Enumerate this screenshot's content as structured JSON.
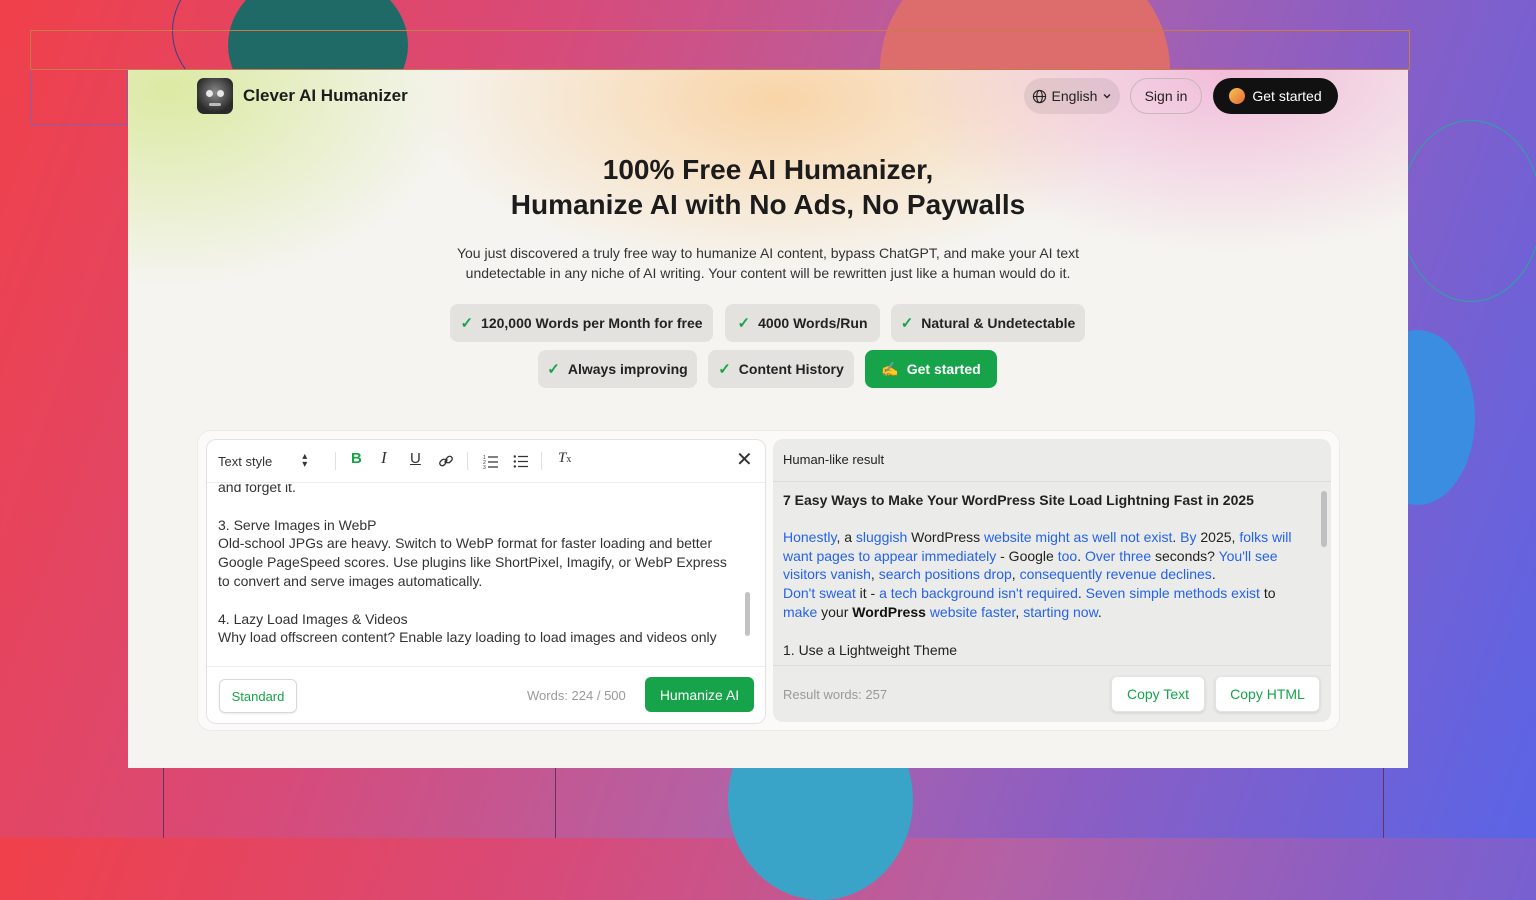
{
  "brand": {
    "name": "Clever AI Humanizer"
  },
  "nav": {
    "language": "English",
    "sign_in": "Sign in",
    "get_started": "Get started"
  },
  "hero": {
    "title_line1": "100% Free AI Humanizer,",
    "title_line2": "Humanize AI with No Ads, No Paywalls",
    "subtitle": "You just discovered a truly free way to humanize AI content, bypass ChatGPT, and make your AI text undetectable in any niche of AI writing. Your content will be rewritten just like a human would do it."
  },
  "features": [
    {
      "label": "120,000 Words per Month for free"
    },
    {
      "label": "4000 Words/Run"
    },
    {
      "label": "Natural & Undetectable"
    },
    {
      "label": "Always improving"
    },
    {
      "label": "Content History"
    }
  ],
  "cta": {
    "label": "Get started",
    "emoji": "✍️"
  },
  "editor": {
    "text_style": "Text style",
    "content": [
      "and forget it.",
      "3. Serve Images in WebP\nOld-school JPGs are heavy. Switch to WebP format for faster loading and better Google PageSpeed scores. Use plugins like ShortPixel, Imagify, or WebP Express to convert and serve images automatically.",
      "4. Lazy Load Images & Videos\nWhy load offscreen content? Enable lazy loading to load images and videos only"
    ],
    "mode": "Standard",
    "word_count": "Words: 224 / 500",
    "humanize": "Humanize AI"
  },
  "result": {
    "header": "Human-like result",
    "title": "7 Easy Ways to Make Your WordPress Site Load Lightning Fast in 2025",
    "segments": [
      {
        "t": "Honestly",
        "hl": true
      },
      {
        "t": ", a ",
        "hl": false
      },
      {
        "t": "sluggish",
        "hl": true
      },
      {
        "t": " WordPress ",
        "hl": false
      },
      {
        "t": "website might as well not exist",
        "hl": true
      },
      {
        "t": ". ",
        "hl": false
      },
      {
        "t": "By",
        "hl": true
      },
      {
        "t": " 2025, ",
        "hl": false
      },
      {
        "t": "folks will want pages to appear immediately",
        "hl": true
      },
      {
        "t": " - Google ",
        "hl": false
      },
      {
        "t": "too",
        "hl": true
      },
      {
        "t": ". ",
        "hl": false
      },
      {
        "t": "Over three",
        "hl": true
      },
      {
        "t": " seconds? ",
        "hl": false
      },
      {
        "t": "You'll see visitors vanish",
        "hl": true
      },
      {
        "t": ", ",
        "hl": false
      },
      {
        "t": "search positions drop",
        "hl": true
      },
      {
        "t": ", ",
        "hl": false
      },
      {
        "t": "consequently revenue declines",
        "hl": true
      },
      {
        "t": ".",
        "hl": false
      },
      {
        "t": "\n",
        "hl": false
      },
      {
        "t": "Don't sweat",
        "hl": true
      },
      {
        "t": " it - ",
        "hl": false
      },
      {
        "t": "a tech background isn't required",
        "hl": true
      },
      {
        "t": ". ",
        "hl": false
      },
      {
        "t": "Seven simple methods exist",
        "hl": true
      },
      {
        "t": " to ",
        "hl": false
      },
      {
        "t": "make",
        "hl": true
      },
      {
        "t": " your ",
        "hl": false
      },
      {
        "t": "WordPress",
        "hl": false,
        "bold": true
      },
      {
        "t": " ",
        "hl": false
      },
      {
        "t": "website faster",
        "hl": true
      },
      {
        "t": ", ",
        "hl": false
      },
      {
        "t": "starting now",
        "hl": true
      },
      {
        "t": ".",
        "hl": false
      }
    ],
    "next_heading": "1. Use a Lightweight Theme",
    "word_count": "Result words: 257",
    "copy_text": "Copy Text",
    "copy_html": "Copy HTML"
  },
  "colors": {
    "accent": "#16a34a",
    "link": "#2563eb",
    "dark": "#111111"
  }
}
